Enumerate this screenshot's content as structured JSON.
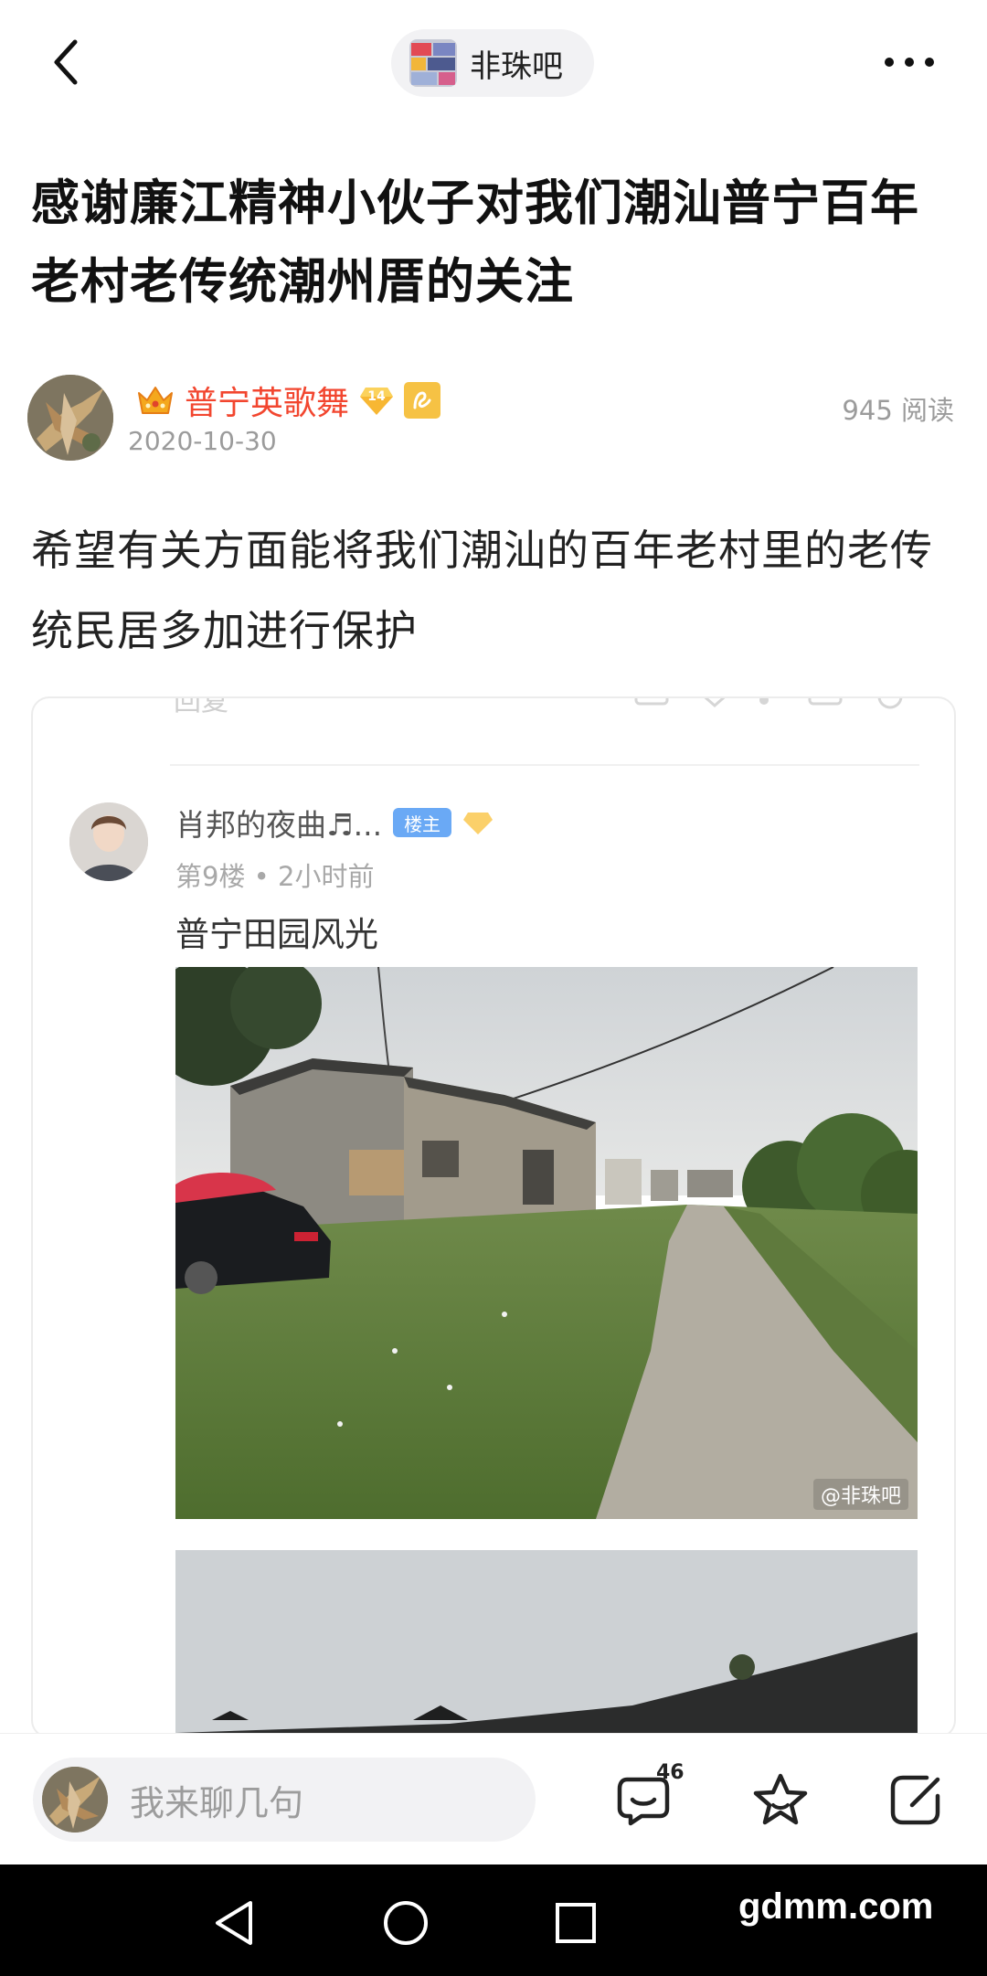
{
  "header": {
    "forum_name": "非珠吧",
    "back_icon": "chevron-left-icon",
    "more_icon": "more-dots-icon"
  },
  "post": {
    "title": "感谢廉江精神小伙子对我们潮汕普宁百年老村老传统潮州厝的关注",
    "author_name": "普宁英歌舞",
    "author_level": "14",
    "date": "2020-10-30",
    "read_count": "945 阅读",
    "body": "希望有关方面能将我们潮汕的百年老村里的老传统民居多加进行保护"
  },
  "embedded_screenshot": {
    "cut_text": "回复",
    "username": "肖邦的夜曲♬...",
    "owner_badge": "楼主",
    "meta": "第9楼 • 2小时前",
    "caption": "普宁田园风光",
    "watermark": "@非珠吧"
  },
  "comment_bar": {
    "placeholder": "我来聊几句",
    "comment_count": "46"
  },
  "system": {
    "site_mark": "gdmm.com"
  },
  "colors": {
    "author_name": "#f2462f",
    "muted_text": "#9b9b9b",
    "owner_badge": "#6aa9f5",
    "role_badge": "#f6c244"
  }
}
